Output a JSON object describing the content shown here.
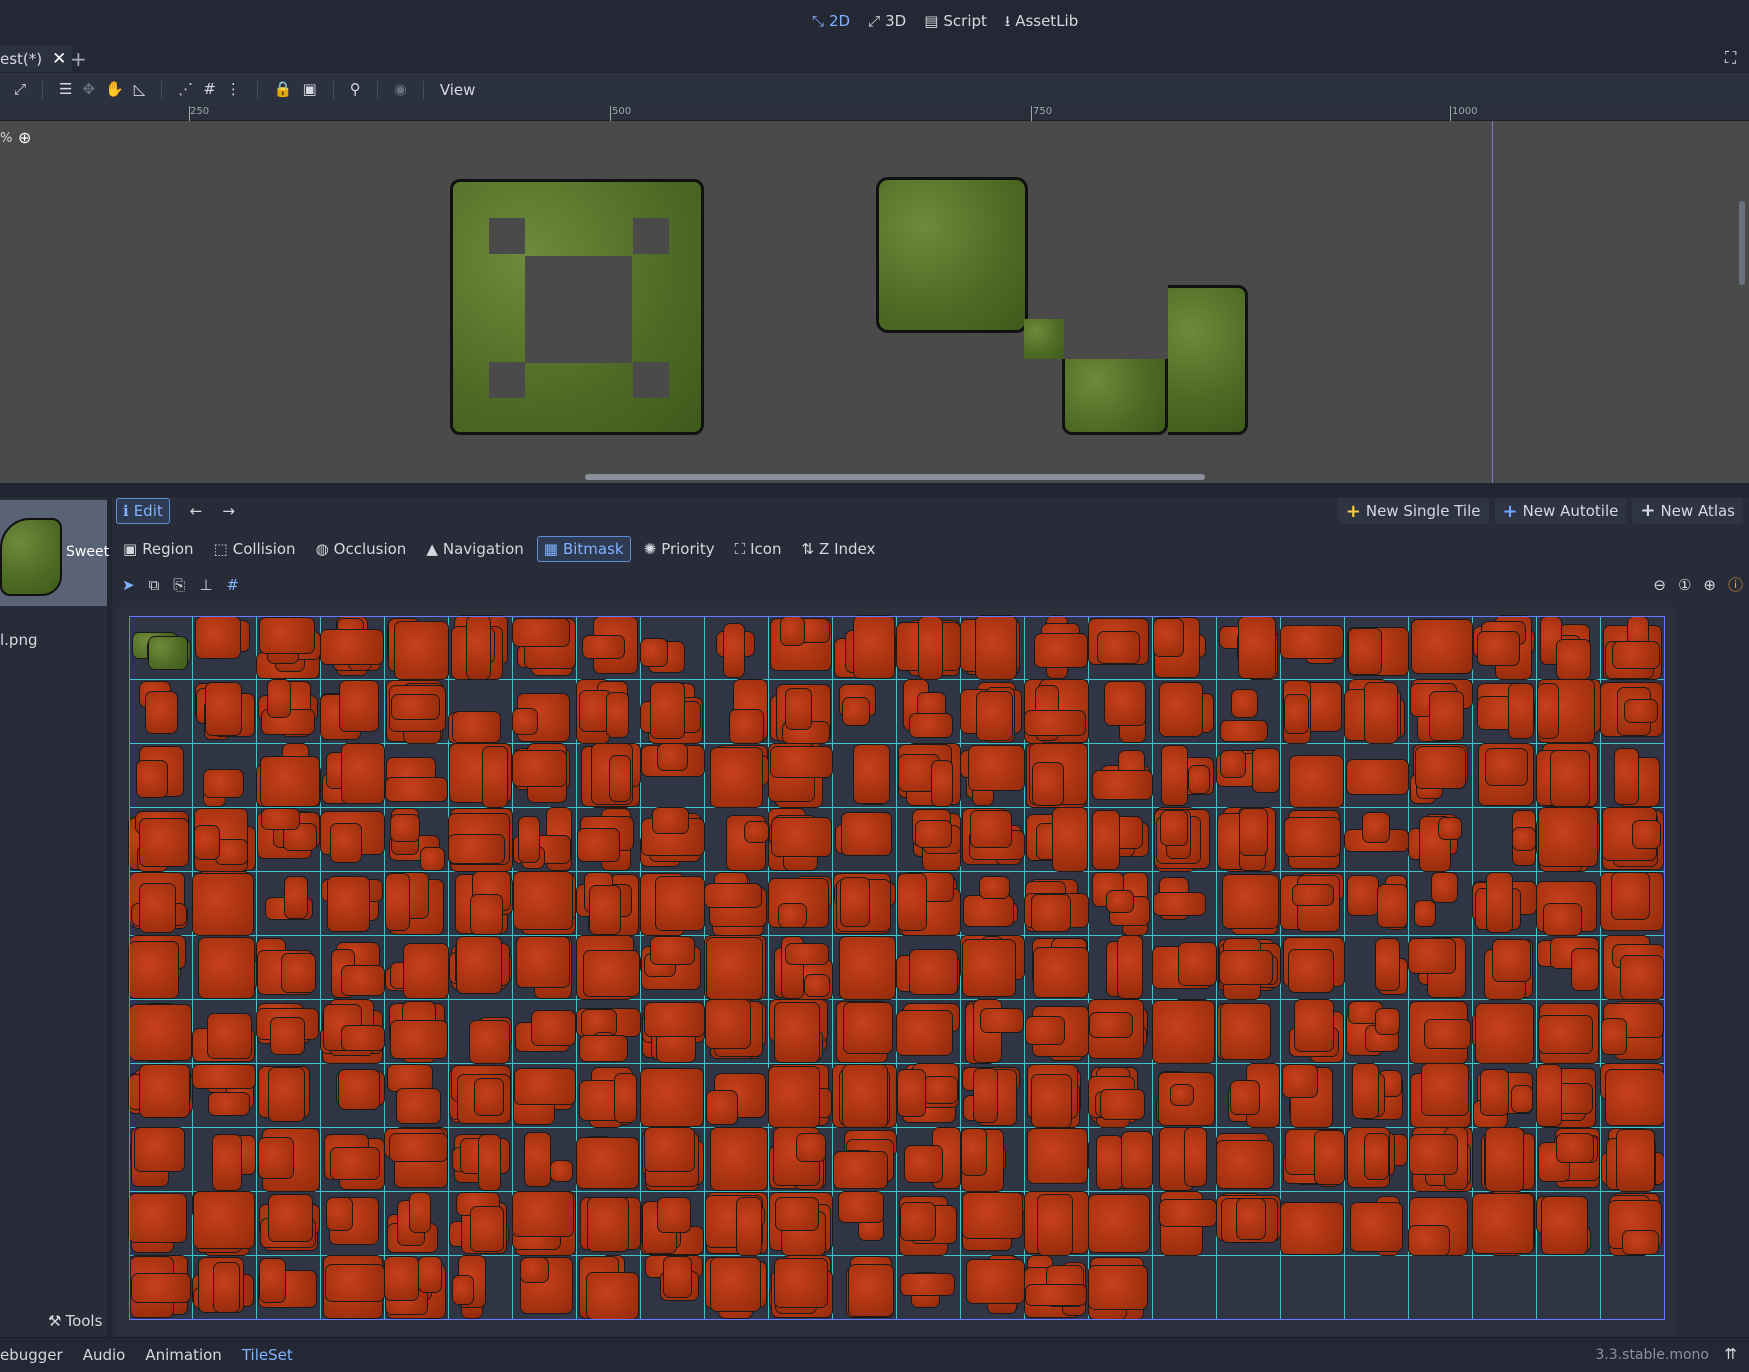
{
  "main_modes": [
    {
      "label": "2D",
      "icon": "2d-icon",
      "active": true
    },
    {
      "label": "3D",
      "icon": "3d-icon",
      "active": false
    },
    {
      "label": "Script",
      "icon": "script-icon",
      "active": false
    },
    {
      "label": "AssetLib",
      "icon": "assetlib-icon",
      "active": false
    }
  ],
  "scene_tab": {
    "label": "est(*)"
  },
  "toolbar": {
    "view_label": "View"
  },
  "ruler": {
    "marks": [
      "250",
      "500",
      "750",
      "1000"
    ]
  },
  "viewport": {
    "zoom_label": "%"
  },
  "tileset": {
    "edit_label": "Edit",
    "new_single_tile": "New Single Tile",
    "new_autotile": "New Autotile",
    "new_atlas": "New Atlas",
    "modes": [
      {
        "label": "Region",
        "active": false
      },
      {
        "label": "Collision",
        "active": false
      },
      {
        "label": "Occlusion",
        "active": false
      },
      {
        "label": "Navigation",
        "active": false
      },
      {
        "label": "Bitmask",
        "active": true
      },
      {
        "label": "Priority",
        "active": false
      },
      {
        "label": "Icon",
        "active": false
      },
      {
        "label": "Z Index",
        "active": false
      }
    ],
    "texture_label": "Sweet",
    "texture_file": "l.png",
    "tools_label": "Tools"
  },
  "bottom_tabs": [
    {
      "label": "ebugger",
      "active": false
    },
    {
      "label": "Audio",
      "active": false
    },
    {
      "label": "Animation",
      "active": false
    },
    {
      "label": "TileSet",
      "active": true
    }
  ],
  "version": "3.3.stable.mono",
  "colors": {
    "accent": "#7fb2ff",
    "grid": "#3fc4c7",
    "lava": "#a83310",
    "moss": "#55712a",
    "background": "#202531"
  }
}
